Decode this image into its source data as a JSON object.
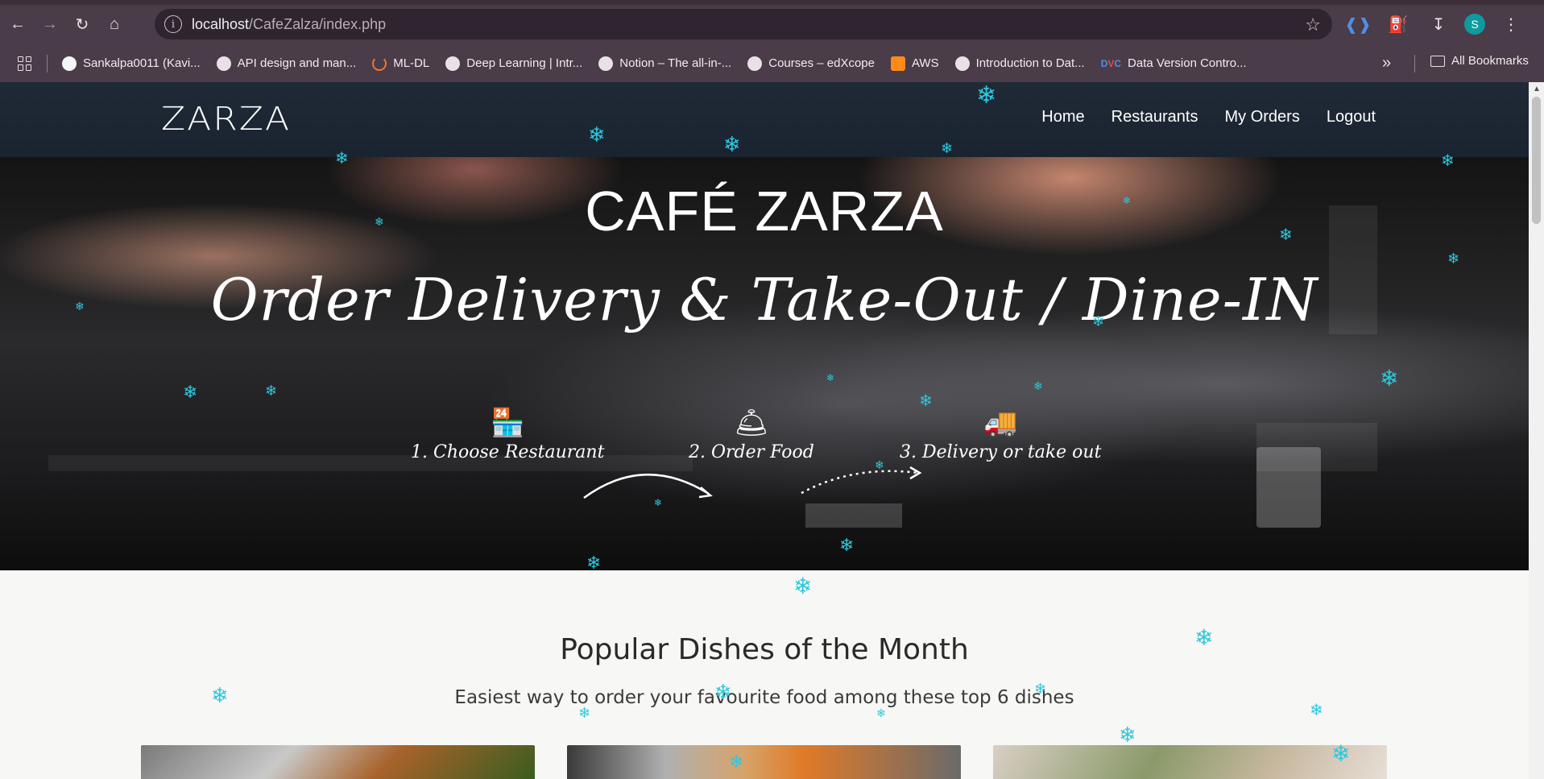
{
  "browser": {
    "url_host": "localhost",
    "url_path": "/CafeZalza/index.php",
    "profile_initial": "S",
    "bookmarks": [
      "Sankalpa0011 (Kavi...",
      "API design and man...",
      "ML-DL",
      "Deep Learning | Intr...",
      "Notion – The all-in-...",
      "Courses – edXcope",
      "AWS",
      "Introduction to Dat...",
      "Data Version Contro..."
    ],
    "all_bookmarks": "All Bookmarks"
  },
  "site": {
    "logo": "ZARZA",
    "nav": [
      "Home",
      "Restaurants",
      "My Orders",
      "Logout"
    ]
  },
  "hero": {
    "title": "CAFÉ ZARZA",
    "subtitle": "Order Delivery & Take-Out / Dine-IN",
    "steps": [
      "1. Choose Restaurant",
      "2. Order Food",
      "3. Delivery or take out"
    ]
  },
  "section": {
    "title": "Popular Dishes of the Month",
    "subtitle": "Easiest way to order your favourite food among these top 6 dishes"
  },
  "colors": {
    "browser_chrome": "#4a3c48",
    "header_bg": "#1f2a36",
    "snowflake": "#2ec8dd",
    "page_bg": "#f7f7f5"
  }
}
